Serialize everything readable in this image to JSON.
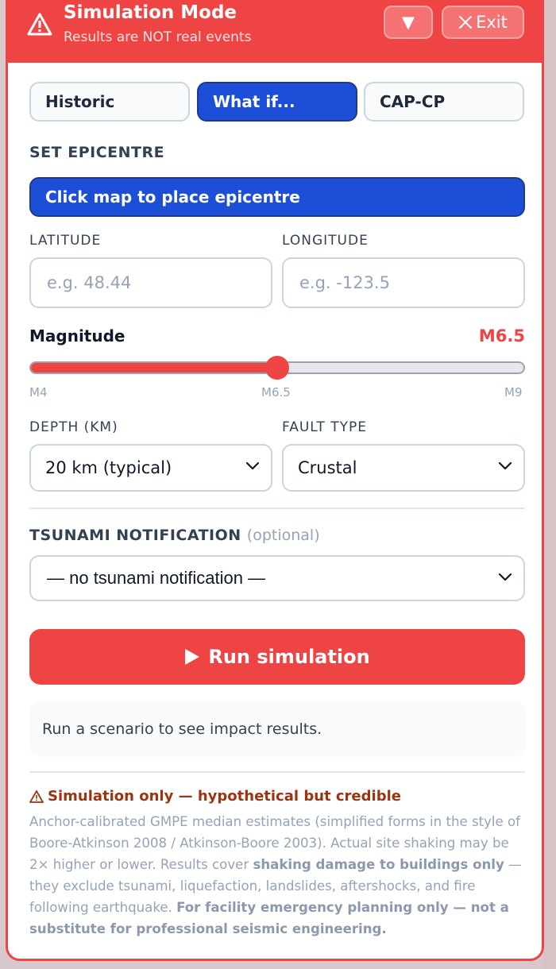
{
  "header": {
    "title": "Simulation Mode",
    "subtitle": "Results are NOT real events",
    "collapse_label": "▼",
    "exit_label": "Exit"
  },
  "tabs": [
    {
      "label": "Historic",
      "active": false
    },
    {
      "label": "What if...",
      "active": true
    },
    {
      "label": "CAP-CP",
      "active": false
    }
  ],
  "epicentre": {
    "section_label": "SET EPICENTRE",
    "map_button_label": "Click map to place epicentre",
    "latitude_label": "LATITUDE",
    "latitude_placeholder": "e.g. 48.44",
    "latitude_value": "",
    "longitude_label": "LONGITUDE",
    "longitude_placeholder": "e.g. -123.5",
    "longitude_value": ""
  },
  "magnitude": {
    "label": "Magnitude",
    "value_text": "M6.5",
    "min": 4,
    "max": 9,
    "value": 6.5,
    "tick_min": "M4",
    "tick_mid": "M6.5",
    "tick_max": "M9"
  },
  "depth": {
    "label": "DEPTH (KM)",
    "selected": "20 km (typical)"
  },
  "fault": {
    "label": "FAULT TYPE",
    "selected": "Crustal"
  },
  "tsunami": {
    "label": "TSUNAMI NOTIFICATION",
    "optional_text": "(optional)",
    "selected": "— no tsunami notification —"
  },
  "run_button_label": "Run simulation",
  "result_placeholder": "Run a scenario to see impact results.",
  "disclaimer": {
    "title": "Simulation only — hypothetical but credible",
    "text_1": "Anchor-calibrated GMPE median estimates (simplified forms in the style of Boore-Atkinson 2008 / Atkinson-Boore 2003). Actual site shaking may be 2× higher or lower. Results cover ",
    "bold_1": "shaking damage to buildings only",
    "text_2": " — they exclude tsunami, liquefaction, landslides, aftershocks, and fire following earthquake. ",
    "bold_2": "For facility emergency planning only — not a substitute for professional seismic engineering."
  },
  "colors": {
    "accent_red": "#ef4444",
    "accent_blue": "#1d4ed8",
    "warning_text": "#9a3412"
  }
}
